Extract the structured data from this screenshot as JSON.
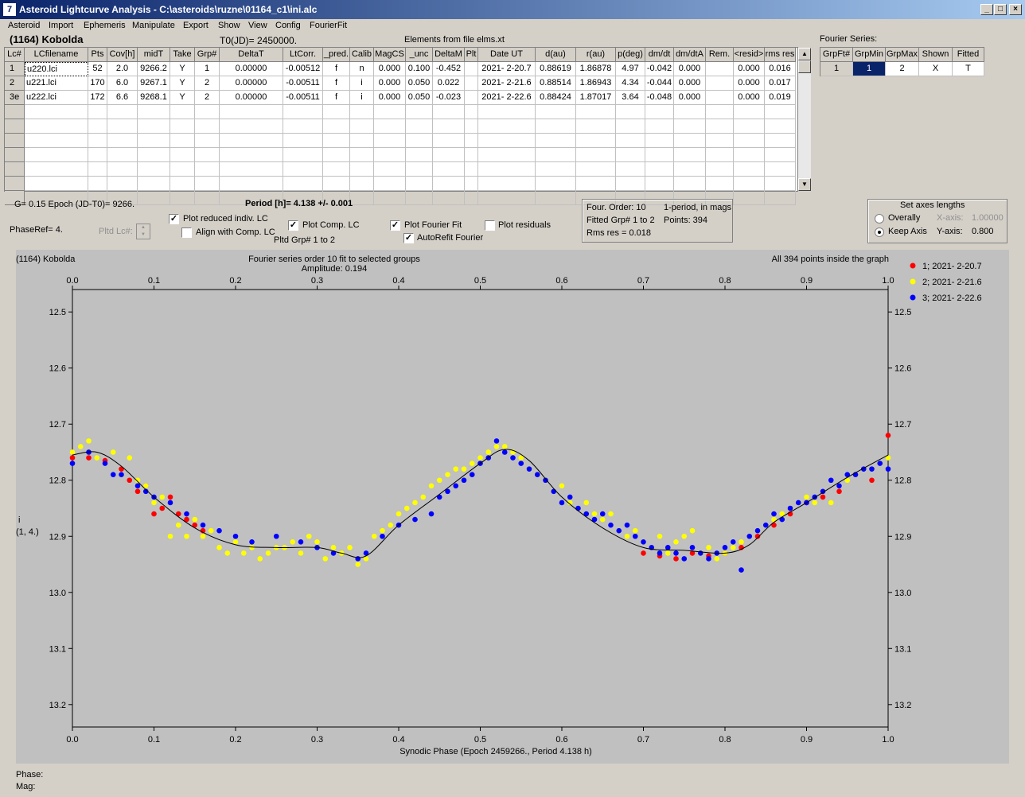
{
  "window": {
    "title": "Asteroid Lightcurve Analysis - C:\\asteroids\\ruzne\\01164_c1\\ini.alc",
    "icon_name": "app-icon"
  },
  "menu": [
    "Asteroid",
    "Import",
    "Ephemeris",
    "Manipulate",
    "Export",
    "Show",
    "View",
    "Config",
    "FourierFit"
  ],
  "header": {
    "object": "(1164) Kobolda",
    "t0": "T0(JD)= 2450000.",
    "elements": "Elements from file elms.xt"
  },
  "lc_table": {
    "columns": [
      "Lc#",
      "LCfilename",
      "Pts",
      "Cov[h]",
      "midT",
      "Take",
      "Grp#",
      "DeltaT",
      "LtCorr.",
      "_pred.",
      "Calib",
      "MagCS",
      "_unc",
      "DeltaM",
      "Plt",
      "Date UT",
      "d(au)",
      "r(au)",
      "p(deg)",
      "dm/dt",
      "dm/dtA",
      "Rem.",
      "<resid>",
      "rms res"
    ],
    "rows": [
      [
        "1",
        "u220.lci",
        "52",
        "2.0",
        "9266.2",
        "Y",
        "1",
        "0.00000",
        "-0.00512",
        "f",
        "n",
        "0.000",
        "0.100",
        "-0.452",
        "",
        "2021- 2-20.7",
        "0.88619",
        "1.86878",
        "4.97",
        "-0.042",
        "0.000",
        "",
        "0.000",
        "0.016"
      ],
      [
        "2",
        "u221.lci",
        "170",
        "6.0",
        "9267.1",
        "Y",
        "2",
        "0.00000",
        "-0.00511",
        "f",
        "i",
        "0.000",
        "0.050",
        "0.022",
        "",
        "2021- 2-21.6",
        "0.88514",
        "1.86943",
        "4.34",
        "-0.044",
        "0.000",
        "",
        "0.000",
        "0.017"
      ],
      [
        "3e",
        "u222.lci",
        "172",
        "6.6",
        "9268.1",
        "Y",
        "2",
        "0.00000",
        "-0.00511",
        "f",
        "i",
        "0.000",
        "0.050",
        "-0.023",
        "",
        "2021- 2-22.6",
        "0.88424",
        "1.87017",
        "3.64",
        "-0.048",
        "0.000",
        "",
        "0.000",
        "0.019"
      ]
    ]
  },
  "fourier_table": {
    "title": "Fourier Series:",
    "columns": [
      "GrpFt#",
      "GrpMin",
      "GrpMax",
      "Shown",
      "Fitted"
    ],
    "row": [
      "1",
      "1",
      "2",
      "X",
      "T"
    ]
  },
  "controls": {
    "g_epoch": "G= 0.15    Epoch (JD-T0)= 9266.",
    "period": "Period [h]= 4.138 +/- 0.001",
    "phaseref": "PhaseRef= 4.",
    "pltd_lc": "Pltd Lc#:",
    "plot_reduced": "Plot reduced indiv. LC",
    "align_comp": "Align with Comp. LC",
    "plot_comp": "Plot Comp. LC",
    "pltd_grp": "Pltd Grp#  1   to   2",
    "plot_fourier": "Plot Fourier Fit",
    "autorefit": "AutoRefit Fourier",
    "plot_residuals": "Plot residuals",
    "checks": {
      "plot_reduced": true,
      "align_comp": false,
      "plot_comp": true,
      "plot_fourier": true,
      "autorefit": true,
      "plot_residuals": false
    }
  },
  "fit_info": {
    "order": "Four. Order: 10",
    "mode": "1-period, in mags",
    "fitted": "Fitted Grp# 1 to 2",
    "points": "Points: 394",
    "rms": "Rms res      = 0.018"
  },
  "axes_box": {
    "title": "Set axes lengths",
    "overally": "Overally",
    "keep_axis": "Keep Axis",
    "xaxis_label": "X-axis:",
    "xaxis_value": "1.00000",
    "yaxis_label": "Y-axis:",
    "yaxis_value": "0.800",
    "selected": "keep_axis"
  },
  "chart_data": {
    "type": "scatter",
    "object_label": "(1164) Kobolda",
    "title": "Fourier series order 10 fit to selected groups",
    "subtitle": "Amplitude: 0.194",
    "note": "All 394 points inside the graph",
    "xlabel": "Synodic Phase (Epoch 2459266., Period 4.138 h)",
    "ylabel_1": "i",
    "ylabel_2": "(1, 4.)",
    "xlim": [
      0,
      1
    ],
    "ylim": [
      12.46,
      13.24
    ],
    "x_ticks": [
      "0.0",
      "0.1",
      "0.2",
      "0.3",
      "0.4",
      "0.5",
      "0.6",
      "0.7",
      "0.8",
      "0.9",
      "1.0"
    ],
    "y_ticks": [
      "12.5",
      "12.6",
      "12.7",
      "12.8",
      "12.9",
      "13.0",
      "13.1",
      "13.2"
    ],
    "y_tick_values": [
      12.5,
      12.6,
      12.7,
      12.8,
      12.9,
      13.0,
      13.1,
      13.2
    ],
    "fit_curve": {
      "x": [
        0.0,
        0.03,
        0.06,
        0.1,
        0.15,
        0.2,
        0.25,
        0.3,
        0.33,
        0.36,
        0.4,
        0.45,
        0.5,
        0.53,
        0.56,
        0.6,
        0.65,
        0.7,
        0.75,
        0.8,
        0.83,
        0.86,
        0.9,
        0.95,
        1.0
      ],
      "y": [
        12.755,
        12.75,
        12.775,
        12.83,
        12.885,
        12.915,
        12.92,
        12.92,
        12.93,
        12.935,
        12.88,
        12.825,
        12.77,
        12.745,
        12.765,
        12.83,
        12.885,
        12.92,
        12.925,
        12.93,
        12.915,
        12.875,
        12.84,
        12.795,
        12.755
      ]
    },
    "series": [
      {
        "name": "1; 2021- 2-20.7",
        "color": "#ff0000",
        "x": [
          0.0,
          0.02,
          0.04,
          0.06,
          0.07,
          0.08,
          0.09,
          0.1,
          0.11,
          0.12,
          0.13,
          0.14,
          0.15,
          0.16,
          0.7,
          0.72,
          0.74,
          0.76,
          0.78,
          0.8,
          0.82,
          0.84,
          0.86,
          0.88,
          0.9,
          0.92,
          0.94,
          0.96,
          0.98,
          1.0
        ],
        "y": [
          12.76,
          12.76,
          12.765,
          12.78,
          12.8,
          12.82,
          12.81,
          12.86,
          12.85,
          12.83,
          12.86,
          12.87,
          12.88,
          12.89,
          12.93,
          12.935,
          12.94,
          12.93,
          12.935,
          12.93,
          12.92,
          12.9,
          12.88,
          12.86,
          12.84,
          12.83,
          12.82,
          12.79,
          12.8,
          12.72
        ]
      },
      {
        "name": "2; 2021- 2-21.6",
        "color": "#ffff00",
        "x": [
          0.0,
          0.01,
          0.02,
          0.03,
          0.04,
          0.05,
          0.06,
          0.07,
          0.08,
          0.09,
          0.1,
          0.11,
          0.12,
          0.13,
          0.14,
          0.15,
          0.16,
          0.17,
          0.18,
          0.19,
          0.2,
          0.21,
          0.22,
          0.23,
          0.24,
          0.25,
          0.26,
          0.27,
          0.28,
          0.29,
          0.3,
          0.31,
          0.32,
          0.33,
          0.34,
          0.35,
          0.36,
          0.37,
          0.38,
          0.39,
          0.4,
          0.41,
          0.42,
          0.43,
          0.44,
          0.45,
          0.46,
          0.47,
          0.48,
          0.49,
          0.5,
          0.51,
          0.52,
          0.53,
          0.54,
          0.55,
          0.56,
          0.57,
          0.58,
          0.59,
          0.6,
          0.61,
          0.62,
          0.63,
          0.64,
          0.65,
          0.66,
          0.67,
          0.68,
          0.69,
          0.7,
          0.71,
          0.72,
          0.73,
          0.74,
          0.75,
          0.76,
          0.77,
          0.78,
          0.79,
          0.8,
          0.81,
          0.82,
          0.83,
          0.84,
          0.85,
          0.86,
          0.87,
          0.88,
          0.89,
          0.9,
          0.91,
          0.92,
          0.93,
          0.94,
          0.95,
          0.96,
          0.97,
          0.98,
          0.99,
          1.0
        ],
        "y": [
          12.75,
          12.74,
          12.73,
          12.76,
          12.77,
          12.75,
          12.79,
          12.76,
          12.8,
          12.81,
          12.84,
          12.83,
          12.9,
          12.88,
          12.9,
          12.87,
          12.9,
          12.89,
          12.92,
          12.93,
          12.91,
          12.93,
          12.92,
          12.94,
          12.93,
          12.92,
          12.92,
          12.91,
          12.93,
          12.9,
          12.91,
          12.94,
          12.92,
          12.93,
          12.92,
          12.95,
          12.94,
          12.9,
          12.89,
          12.88,
          12.86,
          12.85,
          12.84,
          12.83,
          12.81,
          12.8,
          12.79,
          12.78,
          12.78,
          12.77,
          12.76,
          12.75,
          12.74,
          12.74,
          12.75,
          12.76,
          12.78,
          12.79,
          12.8,
          12.82,
          12.81,
          12.84,
          12.85,
          12.84,
          12.86,
          12.87,
          12.86,
          12.89,
          12.9,
          12.89,
          12.91,
          12.92,
          12.9,
          12.93,
          12.91,
          12.9,
          12.89,
          12.93,
          12.92,
          12.94,
          12.93,
          12.92,
          12.91,
          12.9,
          12.89,
          12.88,
          12.87,
          12.86,
          12.85,
          12.84,
          12.83,
          12.84,
          12.82,
          12.84,
          12.81,
          12.8,
          12.79,
          12.78,
          12.78,
          12.77,
          12.76
        ]
      },
      {
        "name": "3; 2021- 2-22.6",
        "color": "#0000ff",
        "x": [
          0.0,
          0.02,
          0.04,
          0.05,
          0.06,
          0.08,
          0.09,
          0.1,
          0.12,
          0.14,
          0.16,
          0.18,
          0.2,
          0.22,
          0.25,
          0.28,
          0.3,
          0.32,
          0.35,
          0.36,
          0.38,
          0.4,
          0.42,
          0.44,
          0.45,
          0.46,
          0.47,
          0.48,
          0.49,
          0.5,
          0.51,
          0.52,
          0.53,
          0.54,
          0.55,
          0.56,
          0.57,
          0.58,
          0.59,
          0.6,
          0.61,
          0.62,
          0.63,
          0.64,
          0.65,
          0.66,
          0.67,
          0.68,
          0.69,
          0.7,
          0.71,
          0.72,
          0.73,
          0.74,
          0.75,
          0.76,
          0.77,
          0.78,
          0.79,
          0.8,
          0.81,
          0.82,
          0.83,
          0.84,
          0.85,
          0.86,
          0.87,
          0.88,
          0.89,
          0.9,
          0.91,
          0.92,
          0.93,
          0.94,
          0.95,
          0.96,
          0.97,
          0.98,
          0.99,
          1.0
        ],
        "y": [
          12.77,
          12.75,
          12.77,
          12.79,
          12.79,
          12.81,
          12.82,
          12.83,
          12.84,
          12.86,
          12.88,
          12.89,
          12.9,
          12.91,
          12.9,
          12.91,
          12.92,
          12.93,
          12.94,
          12.93,
          12.9,
          12.88,
          12.87,
          12.86,
          12.83,
          12.82,
          12.81,
          12.8,
          12.79,
          12.77,
          12.76,
          12.73,
          12.75,
          12.76,
          12.77,
          12.78,
          12.79,
          12.8,
          12.82,
          12.84,
          12.83,
          12.85,
          12.86,
          12.87,
          12.86,
          12.88,
          12.89,
          12.88,
          12.9,
          12.91,
          12.92,
          12.93,
          12.92,
          12.93,
          12.94,
          12.92,
          12.93,
          12.94,
          12.93,
          12.92,
          12.91,
          12.96,
          12.9,
          12.89,
          12.88,
          12.86,
          12.87,
          12.85,
          12.84,
          12.84,
          12.83,
          12.82,
          12.8,
          12.81,
          12.79,
          12.79,
          12.78,
          12.78,
          12.77,
          12.78
        ]
      }
    ],
    "legend_position": "top-right",
    "grid": false
  },
  "status": {
    "phase": "Phase:",
    "mag": "Mag:"
  }
}
